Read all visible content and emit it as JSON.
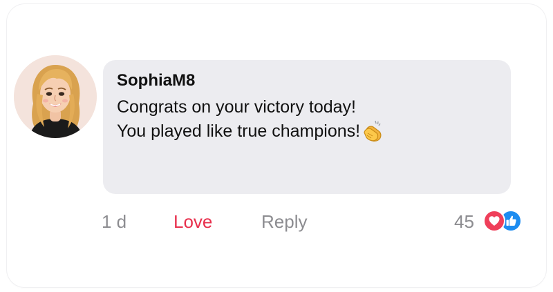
{
  "comment": {
    "username": "SophiaM8",
    "line1": "Congrats on your victory today!",
    "line2": "You played like true champions!",
    "emoji": "clapping-hands-icon"
  },
  "actions": {
    "time": "1 d",
    "love_label": "Love",
    "reply_label": "Reply",
    "reaction_count": "45",
    "reactions": [
      "heart-icon",
      "thumbs-up-icon"
    ]
  },
  "colors": {
    "bubble": "#ececf0",
    "love": "#e8304d",
    "muted": "#8c8c90",
    "heart_badge": "#ef3f5a",
    "like_badge": "#1d8cf0"
  }
}
